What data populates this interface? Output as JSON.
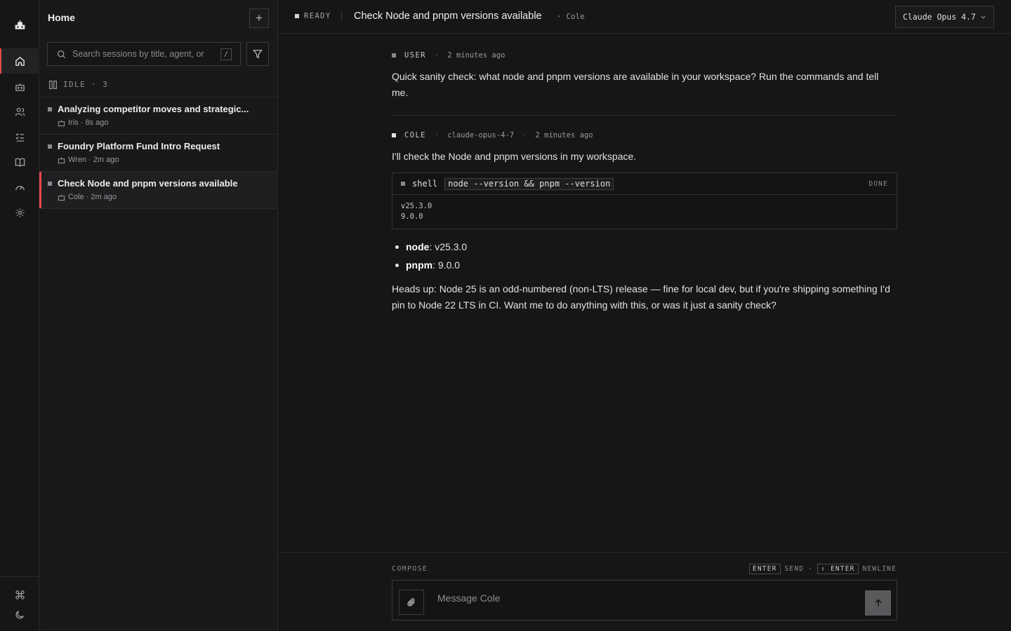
{
  "panel": {
    "title": "Home",
    "new_label": "+",
    "search_placeholder": "Search sessions by title, agent, or",
    "search_shortcut": "/",
    "group": {
      "label": "IDLE",
      "sep": "·",
      "count": "3"
    },
    "sessions": [
      {
        "title": "Analyzing competitor moves and strategic...",
        "meta": "Iris · 8s ago"
      },
      {
        "title": "Foundry Platform Fund Intro Request",
        "meta": "Wren · 2m ago"
      },
      {
        "title": "Check Node and pnpm versions available",
        "meta": "Cole · 2m ago"
      }
    ]
  },
  "topbar": {
    "status": "READY",
    "title": "Check Node and pnpm versions available",
    "agent": "· Cole",
    "model": "Claude Opus 4.7"
  },
  "messages": {
    "user": {
      "who": "USER",
      "sep": "·",
      "time": "2 minutes ago",
      "text": "Quick sanity check: what node and pnpm versions are available in your workspace? Run the commands and tell me."
    },
    "agent": {
      "who": "COLE",
      "sep": "·",
      "model": "claude-opus-4-7",
      "sep2": "·",
      "time": "2 minutes ago",
      "intro": "I'll check the Node and pnpm versions in my workspace.",
      "tool": {
        "name": "shell",
        "command": "node --version && pnpm --version",
        "status": "DONE",
        "output": [
          "v25.3.0",
          "9.0.0"
        ]
      },
      "bullets": [
        {
          "key": "node",
          "value": ": v25.3.0"
        },
        {
          "key": "pnpm",
          "value": ": 9.0.0"
        }
      ],
      "outro": "Heads up: Node 25 is an odd-numbered (non-LTS) release — fine for local dev, but if you're shipping something I'd pin to Node 22 LTS in CI. Want me to do anything with this, or was it just a sanity check?"
    }
  },
  "composer": {
    "label": "COMPOSE",
    "enter_key": "ENTER",
    "enter_action": "SEND",
    "hint_sep": "·",
    "shift_enter_key": "⇧ ENTER",
    "shift_enter_action": "NEWLINE",
    "placeholder": "Message Cole"
  },
  "colors": {
    "accent": "#e5484d",
    "background": "#161617",
    "panel": "#19191a"
  },
  "icons": [
    "app-logo-icon",
    "home-icon",
    "agents-icon",
    "people-icon",
    "tasks-icon",
    "library-icon",
    "gauge-icon",
    "settings-icon",
    "command-icon",
    "theme-moon-icon",
    "search-icon",
    "filter-icon",
    "pause-icon",
    "bot-icon",
    "chevron-down-icon",
    "paperclip-icon",
    "arrow-up-icon"
  ]
}
